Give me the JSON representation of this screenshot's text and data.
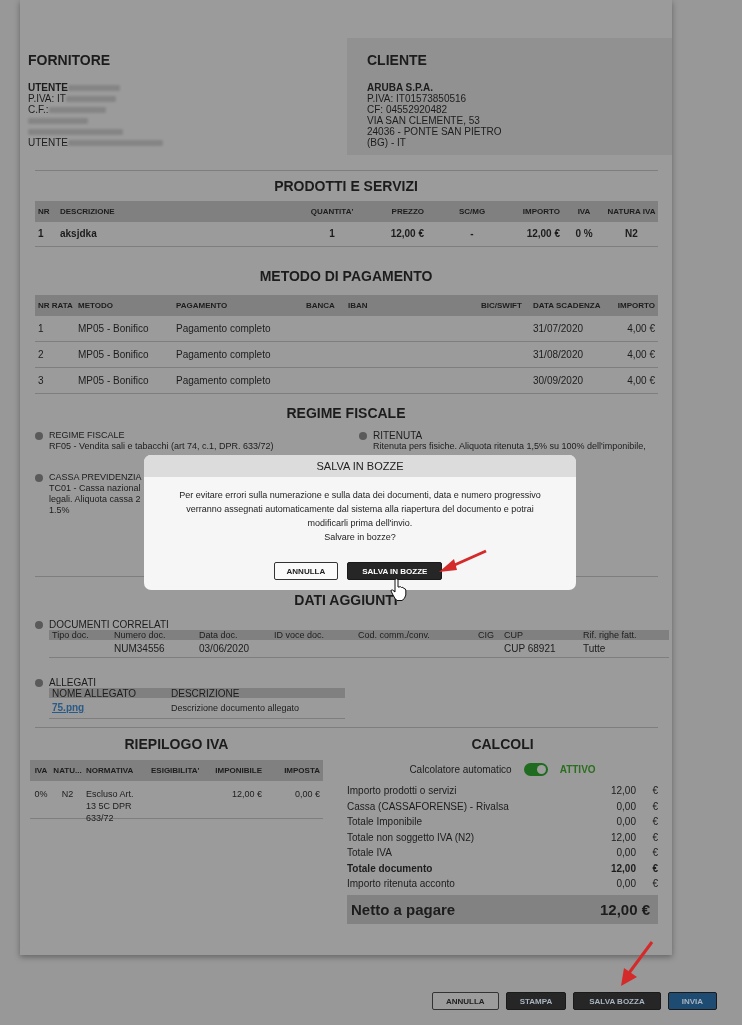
{
  "supplier": {
    "title": "FORNITORE",
    "lines": [
      {
        "label": "UTENTE",
        "redacted": true
      },
      {
        "label": "P.IVA: IT",
        "redacted": true
      },
      {
        "label": "C.F.:",
        "redacted": true
      },
      {
        "redacted": true
      },
      {
        "redacted": true
      },
      {
        "label": "UTENTE",
        "redacted": true
      }
    ]
  },
  "client": {
    "title": "CLIENTE",
    "name": "ARUBA S.P.A.",
    "lines": [
      "P.IVA: IT01573850516",
      "CF: 04552920482",
      "VIA SAN CLEMENTE, 53",
      "24036 - PONTE SAN PIETRO",
      "(BG) - IT"
    ]
  },
  "products": {
    "title": "PRODOTTI E SERVIZI",
    "columns": [
      "NR",
      "DESCRIZIONE",
      "QUANTITA'",
      "PREZZO",
      "SC/MG",
      "IMPORTO",
      "IVA",
      "NATURA IVA"
    ],
    "rows": [
      {
        "cells": [
          "1",
          "aksjdka",
          "1",
          "12,00 €",
          "-",
          "12,00 €",
          "0 %",
          "N2"
        ]
      }
    ]
  },
  "payment": {
    "title": "METODO DI PAGAMENTO",
    "columns": [
      "NR RATA",
      "METODO",
      "PAGAMENTO",
      "BANCA",
      "IBAN",
      "BIC/SWIFT",
      "DATA SCADENZA",
      "IMPORTO"
    ],
    "rows": [
      {
        "nr": "1",
        "method": "MP05 - Bonifico",
        "payment": "Pagamento completo",
        "due": "31/07/2020",
        "amount": "4,00 €"
      },
      {
        "nr": "2",
        "method": "MP05 - Bonifico",
        "payment": "Pagamento completo",
        "due": "31/08/2020",
        "amount": "4,00 €"
      },
      {
        "nr": "3",
        "method": "MP05 - Bonifico",
        "payment": "Pagamento completo",
        "due": "30/09/2020",
        "amount": "4,00 €"
      }
    ]
  },
  "fiscal": {
    "title": "REGIME FISCALE",
    "left": [
      {
        "title": "REGIME FISCALE",
        "lines": [
          "RF05 - Vendita sali e tabacchi (art 74, c.1, DPR. 633/72)"
        ]
      },
      {
        "title": "CASSA PREVIDENZIA",
        "lines": [
          "TC01 - Cassa nazional",
          "legali. Aliquota cassa 2",
          "1.5%"
        ]
      }
    ],
    "right": [
      {
        "title": "RITENUTA",
        "lines": [
          "Ritenuta pers fisiche. Aliquota ritenuta 1,5% su 100% dell'imponibile,"
        ]
      }
    ]
  },
  "extra": {
    "title": "DATI AGGIUNTI",
    "documents": {
      "title": "DOCUMENTI CORRELATI",
      "columns": [
        "Tipo doc.",
        "Numero doc.",
        "Data doc.",
        "ID voce doc.",
        "Cod. comm./conv.",
        "CIG",
        "CUP",
        "Rif. righe fatt."
      ],
      "rows": [
        {
          "number": "NUM34556",
          "date": "03/06/2020",
          "cup": "CUP 68921",
          "ref": "Tutte"
        }
      ]
    },
    "attachments": {
      "title": "ALLEGATI",
      "columns": [
        "NOME ALLEGATO",
        "DESCRIZIONE"
      ],
      "rows": [
        {
          "name": "75.png",
          "description": "Descrizione documento allegato"
        }
      ]
    }
  },
  "vat_summary": {
    "title": "RIEPILOGO IVA",
    "columns": [
      "IVA",
      "NATU...",
      "NORMATIVA",
      "ESIGIBILITA'",
      "IMPONIBILE",
      "IMPOSTA"
    ],
    "rows": [
      {
        "cells": [
          "0%",
          "N2",
          "Escluso Art. 13 5C DPR 633/72",
          "",
          "12,00 €",
          "0,00 €"
        ]
      }
    ]
  },
  "calc": {
    "title": "CALCOLI",
    "toggle": {
      "label": "Calcolatore automatico",
      "on": true,
      "status": "ATTIVO"
    },
    "rows": [
      {
        "label": "Importo prodotti o servizi",
        "value": "12,00",
        "currency": "€",
        "bold": false
      },
      {
        "label": "Cassa (CASSAFORENSE) - Rivalsa",
        "value": "0,00",
        "currency": "€",
        "bold": false
      },
      {
        "label": "Totale Imponibile",
        "value": "0,00",
        "currency": "€",
        "bold": false
      },
      {
        "label": "Totale non soggetto IVA (N2)",
        "value": "12,00",
        "currency": "€",
        "bold": false
      },
      {
        "label": "Totale IVA",
        "value": "0,00",
        "currency": "€",
        "bold": false
      },
      {
        "label": "Totale documento",
        "value": "12,00",
        "currency": "€",
        "bold": true
      },
      {
        "label": "Importo ritenuta acconto",
        "value": "0,00",
        "currency": "€",
        "bold": false
      }
    ],
    "net": {
      "label": "Netto a pagare",
      "value": "12,00 €"
    }
  },
  "modal": {
    "title": "SALVA IN BOZZE",
    "message": "Per evitare errori sulla numerazione e sulla data dei documenti, data e numero progressivo verranno assegnati automaticamente dal sistema alla riapertura del documento e potrai modificarli prima dell'invio.",
    "question": "Salvare in bozze?",
    "buttons": [
      {
        "label": "ANNULLA",
        "kind": "outline"
      },
      {
        "label": "SALVA IN BOZZE",
        "kind": "dark"
      }
    ]
  },
  "footer": {
    "buttons": [
      {
        "label": "ANNULLA",
        "kind": "outline"
      },
      {
        "label": "STAMPA",
        "kind": "dark"
      },
      {
        "label": "SALVA BOZZA",
        "kind": "dark"
      },
      {
        "label": "INVIA",
        "kind": "primary"
      }
    ]
  }
}
